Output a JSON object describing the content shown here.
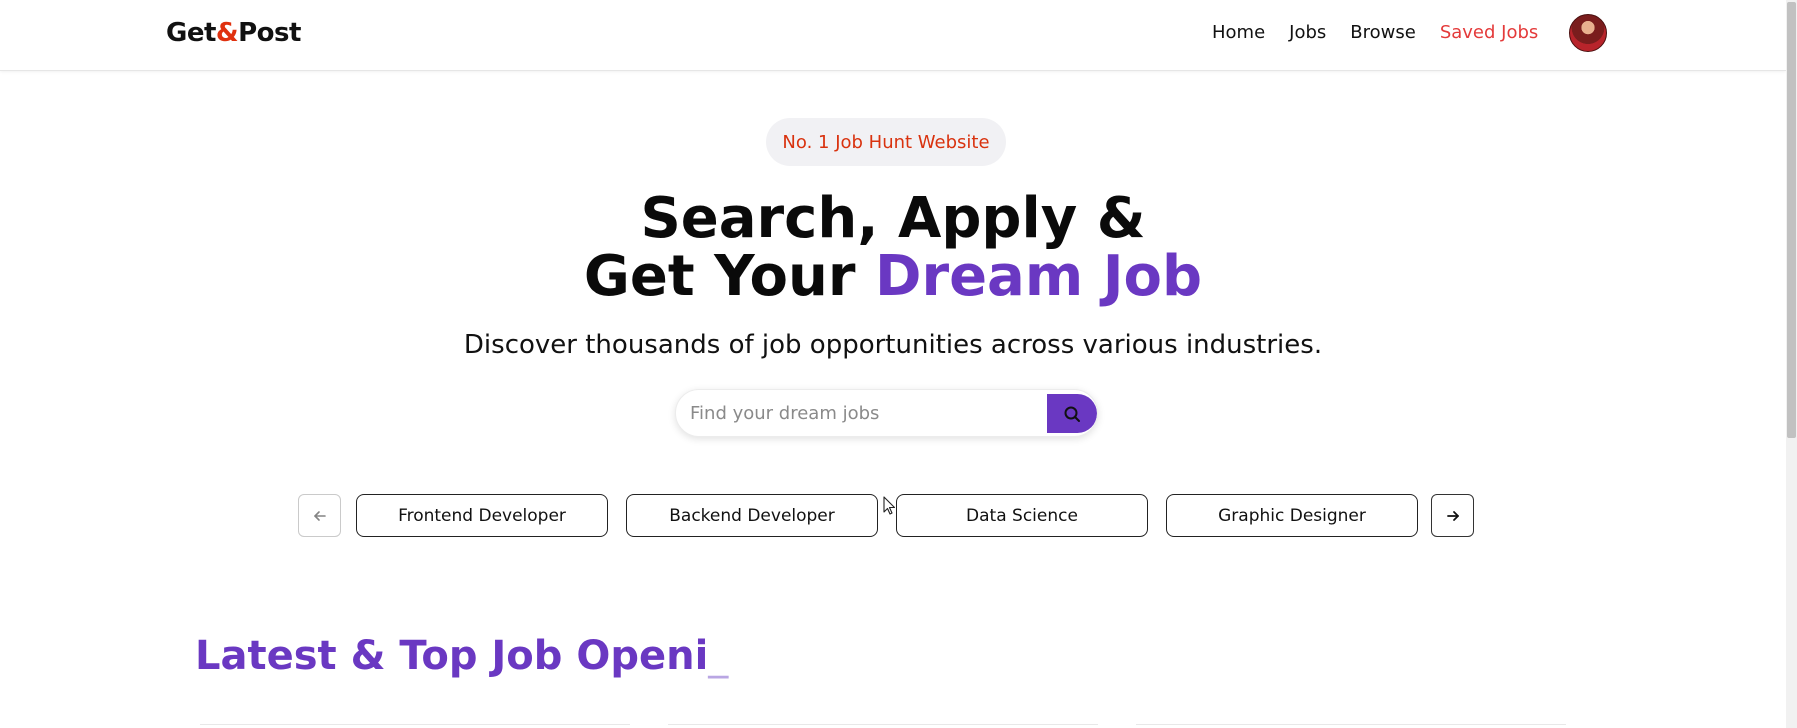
{
  "nav": {
    "logo_part1": "Get",
    "logo_amp": "&",
    "logo_part2": "Post",
    "links": [
      {
        "label": "Home"
      },
      {
        "label": "Jobs"
      },
      {
        "label": "Browse"
      },
      {
        "label": "Saved Jobs"
      }
    ],
    "active_color": "#e43a3a"
  },
  "hero": {
    "badge": "No. 1 Job Hunt Website",
    "title_line1": "Search, Apply &",
    "title_line2_plain": "Get Your ",
    "title_line2_accent": "Dream Job",
    "subtitle": "Discover thousands of job opportunities across various industries.",
    "accent_color": "#6a38c2"
  },
  "search": {
    "placeholder": "Find your dream jobs",
    "value": "",
    "button_icon": "search-icon"
  },
  "categories": {
    "prev_icon": "arrow-left-icon",
    "next_icon": "arrow-right-icon",
    "items": [
      {
        "label": "Frontend Developer"
      },
      {
        "label": "Backend Developer"
      },
      {
        "label": "Data Science"
      },
      {
        "label": "Graphic Designer"
      }
    ]
  },
  "latest": {
    "title": "Latest & Top Job Openi",
    "caret": "_"
  }
}
